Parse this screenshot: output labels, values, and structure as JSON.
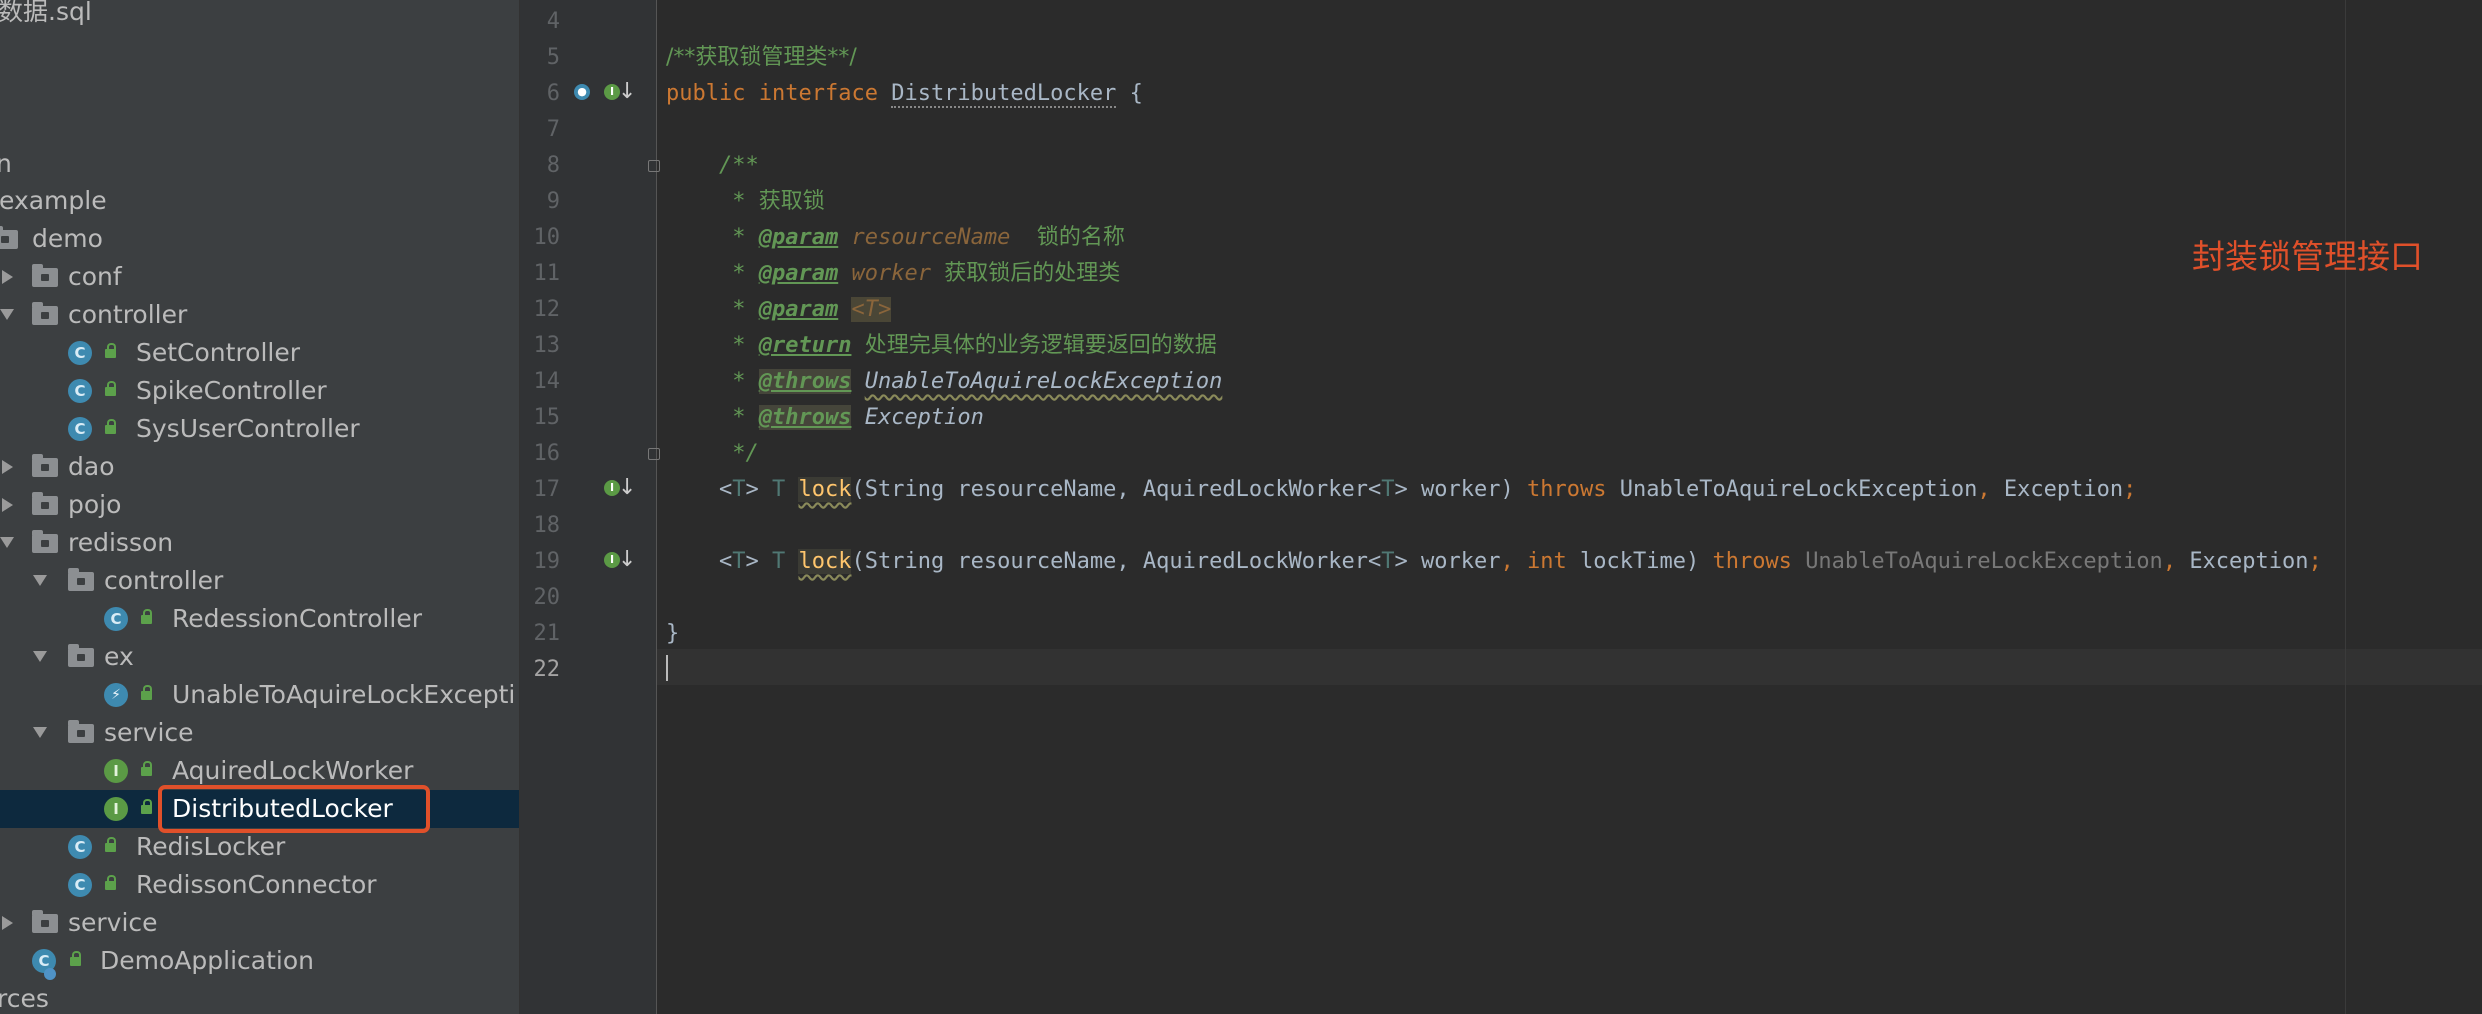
{
  "sidebar": {
    "items": [
      {
        "label": "数据.sql",
        "kind": "file"
      },
      {
        "label": "n",
        "kind": "text"
      },
      {
        "label": "example",
        "kind": "text"
      },
      {
        "label": "demo",
        "kind": "folder"
      },
      {
        "label": "conf",
        "kind": "folder"
      },
      {
        "label": "controller",
        "kind": "folder"
      },
      {
        "label": "SetController",
        "kind": "class"
      },
      {
        "label": "SpikeController",
        "kind": "class"
      },
      {
        "label": "SysUserController",
        "kind": "class"
      },
      {
        "label": "dao",
        "kind": "folder"
      },
      {
        "label": "pojo",
        "kind": "folder"
      },
      {
        "label": "redisson",
        "kind": "folder"
      },
      {
        "label": "controller",
        "kind": "folder"
      },
      {
        "label": "RedessionController",
        "kind": "class"
      },
      {
        "label": "ex",
        "kind": "folder"
      },
      {
        "label": "UnableToAquireLockExcepti",
        "kind": "exception"
      },
      {
        "label": "service",
        "kind": "folder"
      },
      {
        "label": "AquiredLockWorker",
        "kind": "interface"
      },
      {
        "label": "DistributedLocker",
        "kind": "interface",
        "selected": true
      },
      {
        "label": "RedisLocker",
        "kind": "class"
      },
      {
        "label": "RedissonConnector",
        "kind": "class"
      },
      {
        "label": "service",
        "kind": "folder"
      },
      {
        "label": "DemoApplication",
        "kind": "main-class"
      },
      {
        "label": "rces",
        "kind": "text"
      }
    ],
    "icons": {
      "class": "C",
      "interface": "I",
      "exception": "⚡"
    }
  },
  "editor": {
    "line_numbers": [
      "4",
      "5",
      "6",
      "7",
      "8",
      "9",
      "10",
      "11",
      "12",
      "13",
      "14",
      "15",
      "16",
      "17",
      "18",
      "19",
      "20",
      "21",
      "22"
    ],
    "active_line": "22",
    "comment_header": "/**获取锁管理类**/",
    "public_kw": "public",
    "interface_kw": "interface",
    "interface_name": "DistributedLocker",
    "open_brace": " {",
    "doc_open": "/**",
    "doc_star": " * ",
    "doc_desc": "获取锁",
    "tag_param": "@param",
    "tag_return": "@return",
    "tag_throws": "@throws",
    "p_resource": "resourceName",
    "p_resource_desc": "锁的名称",
    "p_worker": "worker",
    "p_worker_desc": "获取锁后的处理类",
    "p_T": "<T>",
    "return_desc": "处理完具体的业务逻辑要返回的数据",
    "ex1": "UnableToAquireLockException",
    "ex2": "Exception",
    "doc_close": " */",
    "generic_open": "<",
    "T": "T",
    "generic_close": ">",
    "method": "lock",
    "sig_part1": "(String resourceName, AquiredLockWorker<",
    "sig_part2": "> worker)",
    "sig2_part2": "> worker",
    "comma": ",",
    "int_kw": "int",
    "lock_time": " lockTime)",
    "throws_kw": "throws",
    "semicolon": ";",
    "close_brace": "}"
  },
  "annotation": "封装锁管理接口",
  "colors": {
    "accent": "#e0502a",
    "selection": "#0d293e",
    "keyword": "#cc7832",
    "comment": "#629755"
  }
}
